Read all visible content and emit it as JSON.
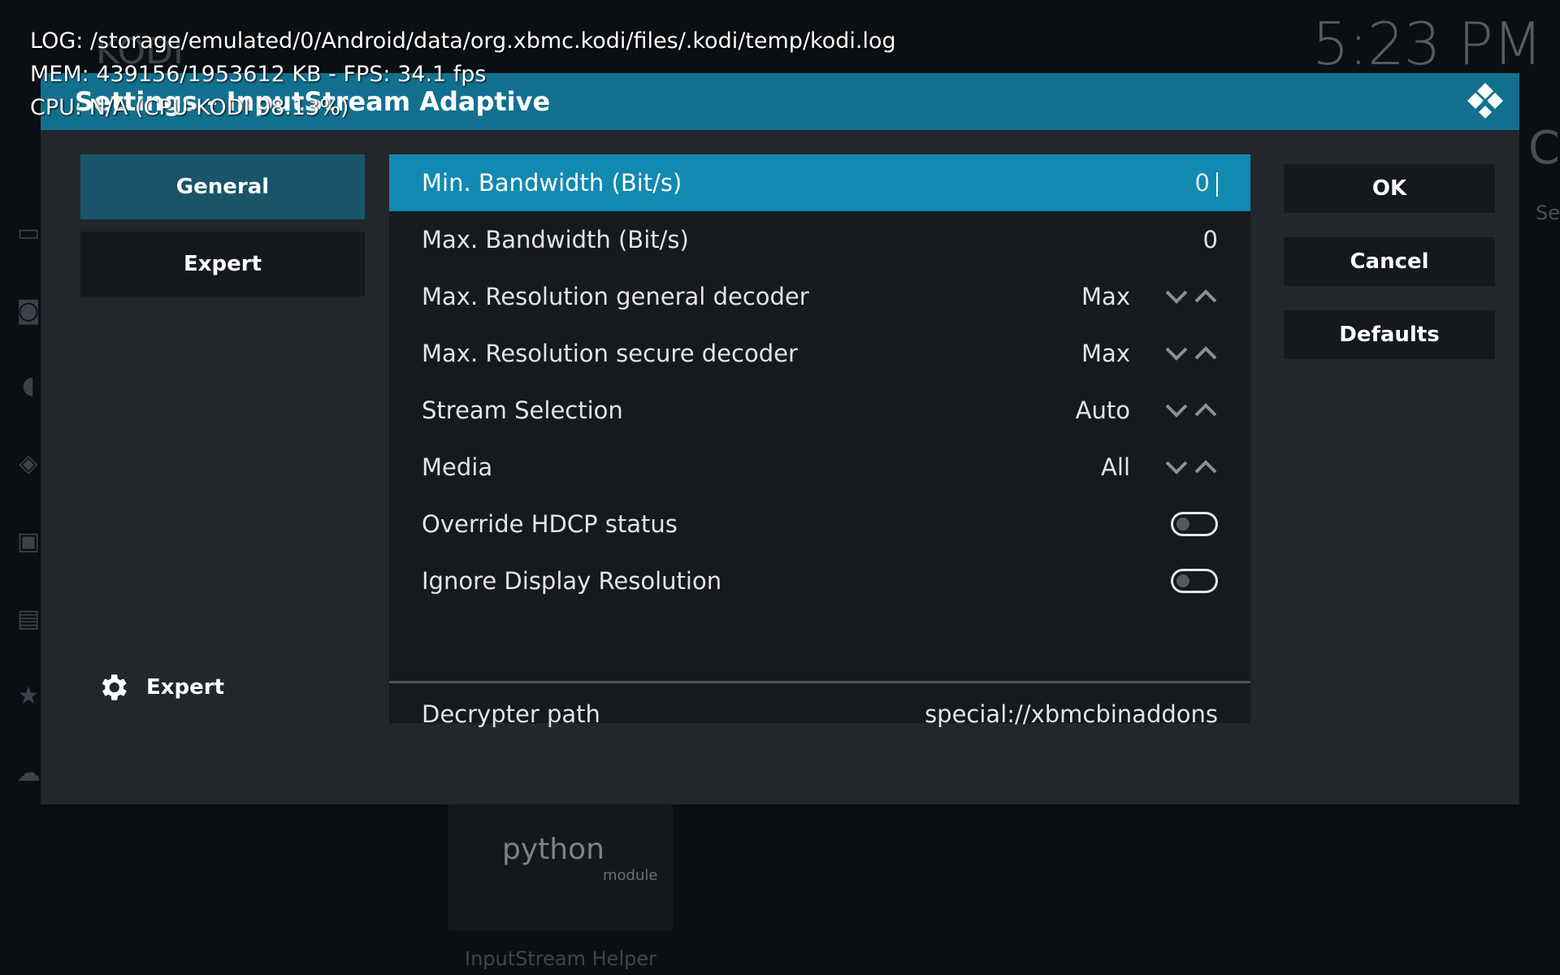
{
  "debug": {
    "log_line": "LOG: /storage/emulated/0/Android/data/org.xbmc.kodi/files/.kodi/temp/kodi.log",
    "mem_line": "MEM: 439156/1953612 KB - FPS: 34.1 fps",
    "cpu_line": "CPU: N/A (CPU-KODI 98.13%)"
  },
  "background": {
    "clock": "5:23 PM",
    "tile_title": "InputStream Helper",
    "python_logo_text": "python",
    "python_logo_sub": "module",
    "kodi_word": "KODI",
    "right_fragment_1": "C",
    "right_fragment_2": "Se"
  },
  "dialog": {
    "title": "Settings - InputStream Adaptive",
    "nav": [
      {
        "label": "General",
        "active": true
      },
      {
        "label": "Expert",
        "active": false
      }
    ],
    "settings_level_label": "Expert",
    "settings": [
      {
        "label": "Min. Bandwidth (Bit/s)",
        "value": "0",
        "type": "number",
        "focused": true
      },
      {
        "label": "Max. Bandwidth (Bit/s)",
        "value": "0",
        "type": "number"
      },
      {
        "label": "Max. Resolution general decoder",
        "value": "Max",
        "type": "spinner"
      },
      {
        "label": "Max. Resolution secure decoder",
        "value": "Max",
        "type": "spinner"
      },
      {
        "label": "Stream Selection",
        "value": "Auto",
        "type": "spinner"
      },
      {
        "label": "Media",
        "value": "All",
        "type": "spinner"
      },
      {
        "label": "Override HDCP status",
        "value": false,
        "type": "toggle"
      },
      {
        "label": "Ignore Display Resolution",
        "value": false,
        "type": "toggle"
      },
      {
        "label": "Decrypter path",
        "value": "special://xbmcbinaddons",
        "type": "path"
      }
    ],
    "buttons": {
      "ok": "OK",
      "cancel": "Cancel",
      "defaults": "Defaults"
    }
  },
  "colors": {
    "header": "#12708f",
    "focus": "#1289b0",
    "nav_active": "#195569",
    "dialog_bg": "#22272c"
  }
}
